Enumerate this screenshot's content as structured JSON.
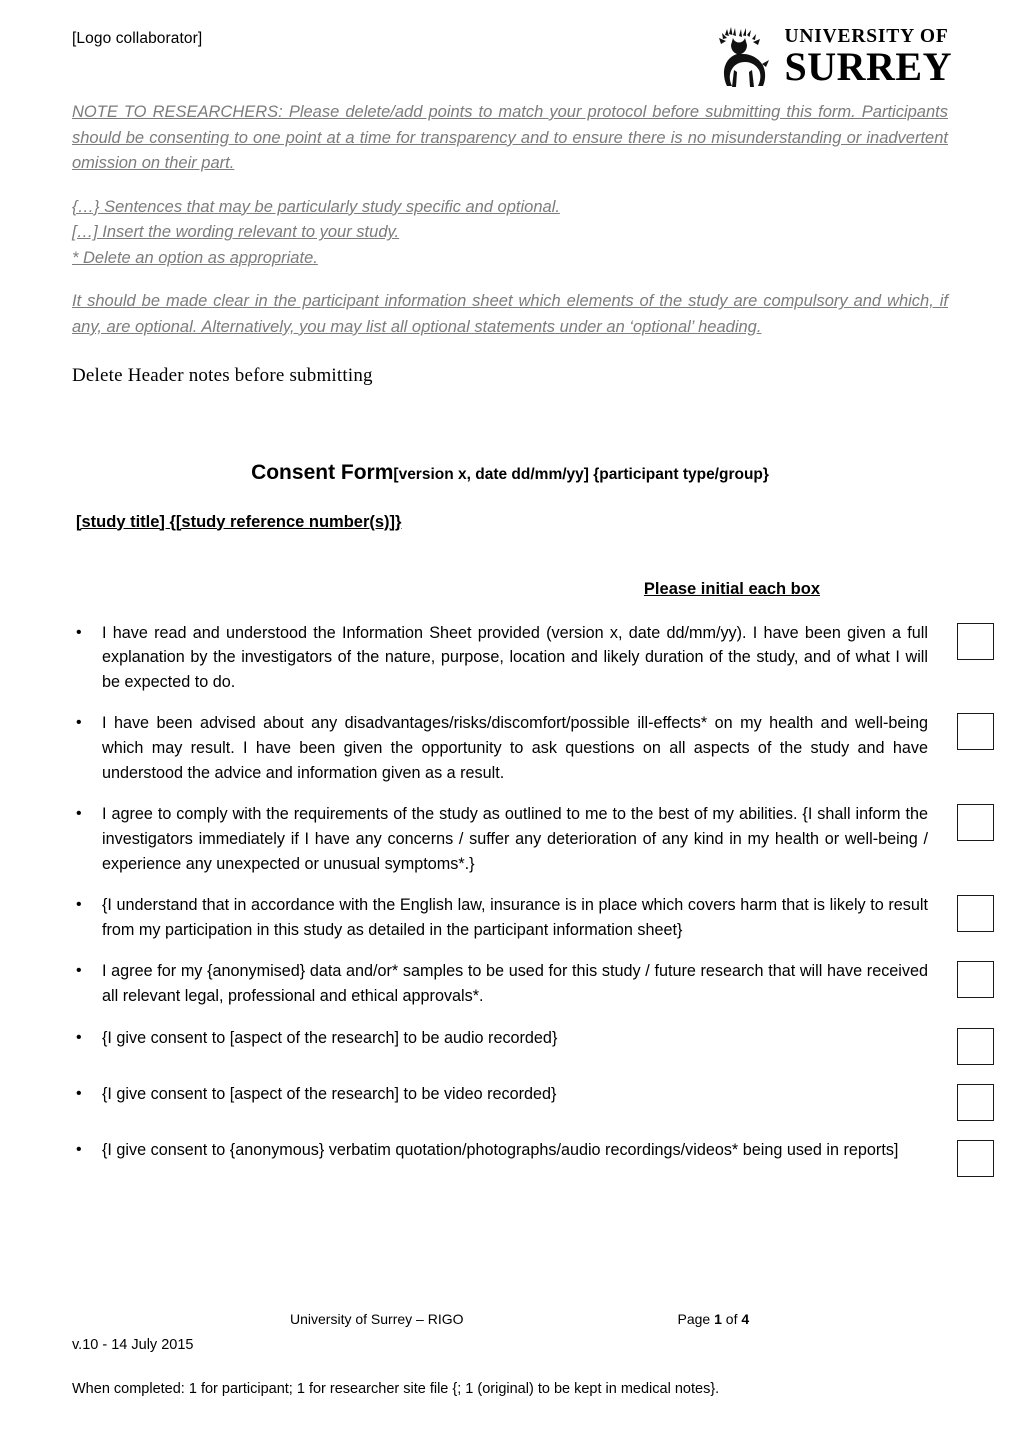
{
  "header": {
    "logo_placeholder": "[Logo collaborator]",
    "university_line1": "UNIVERSITY OF",
    "university_line2": "SURREY",
    "stag_icon": "stag-logo-icon"
  },
  "notes": {
    "para1": "NOTE TO RESEARCHERS: Please delete/add points to match your protocol before submitting this form. Participants should be consenting to one point at a time for transparency and to ensure there is no misunderstanding or inadvertent omission on their part.",
    "legend1": "{…} Sentences that may be particularly study specific and optional.",
    "legend2": "[…] Insert the wording relevant to your study.",
    "legend3": "* Delete an option as appropriate.",
    "para2": "It should be made clear in the participant information sheet which elements of the study are compulsory and which, if any, are optional. Alternatively, you may list all optional statements under an ‘optional’ heading.",
    "delete_header_note": "Delete Header notes before submitting"
  },
  "title": {
    "main": "Consent Form",
    "sub": "[version x, date dd/mm/yy] {participant type/group}",
    "study_title": " [study title] {[study reference number(s)]}   ",
    "initial_instruction": "Please initial each box"
  },
  "items": [
    {
      "bullet": "•",
      "text": "I have read and understood the Information Sheet provided (version x, date dd/mm/yy).  I have been given a full explanation by the investigators of the nature, purpose, location and likely duration of the study, and of what I will be expected to do.",
      "has_box": true
    },
    {
      "bullet": "•",
      "text": "I have been advised about any disadvantages/risks/discomfort/possible ill-effects* on my health and well-being which may result.  I have been given the opportunity to ask questions on all aspects of the study and have understood the advice and information given as a result.",
      "has_box": true
    },
    {
      "bullet": "•",
      "text": "I agree to comply with the requirements of the study as outlined to me to the best of my abilities. {I shall inform the investigators immediately if I have any concerns / suffer any deterioration of any kind in my health or well-being / experience any unexpected or unusual symptoms*.}",
      "has_box": true
    },
    {
      "bullet": "•",
      "text": "{I understand that in accordance with the English law, insurance is in place which covers harm that is likely to result from my participation in this study as detailed in the participant information sheet}",
      "has_box": true
    },
    {
      "bullet": "•",
      "text": "I agree for my {anonymised} data and/or* samples to be used for this study / future research that will have received all relevant legal, professional and ethical approvals*.",
      "has_box": true
    },
    {
      "bullet": "•",
      "text": "{I give consent to [aspect of the research] to be audio recorded}",
      "has_box": true
    },
    {
      "bullet": "•",
      "text": "{I give consent to [aspect of the research] to be video recorded}",
      "has_box": true
    },
    {
      "bullet": "•",
      "text": "{I give consent to {anonymous} verbatim quotation/photographs/audio recordings/videos* being used in reports]",
      "has_box": true
    }
  ],
  "footer": {
    "center": "University of Surrey – RIGO",
    "page_prefix": "Page ",
    "page_number": "1",
    "page_middle": " of ",
    "page_total": "4",
    "version": "v.10  - 14 July 2015",
    "note": "When completed: 1 for participant; 1 for researcher site file {; 1 (original) to be kept in medical notes}."
  }
}
